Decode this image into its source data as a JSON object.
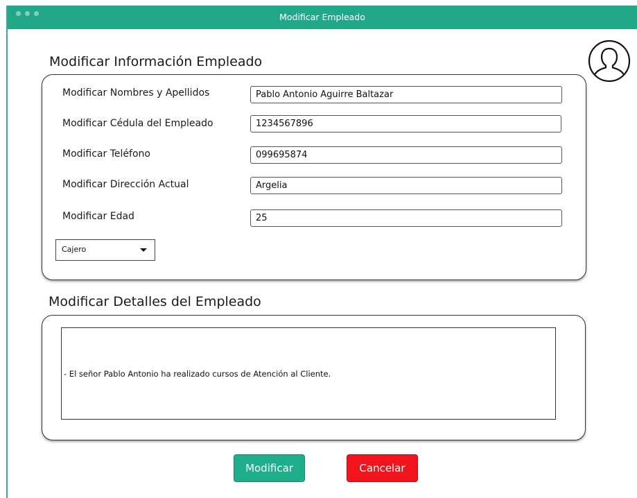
{
  "window": {
    "title": "Modificar Empleado"
  },
  "section_info": {
    "title": "Modificar Información Empleado",
    "fields": [
      {
        "label": "Modificar Nombres y Apellidos",
        "value": "Pablo Antonio Aguirre Baltazar"
      },
      {
        "label": "Modificar Cédula del Empleado",
        "value": "1234567896"
      },
      {
        "label": "Modificar Teléfono",
        "value": "099695874"
      },
      {
        "label": "Modificar Dirección Actual",
        "value": "Argelia"
      },
      {
        "label": "Modificar Edad",
        "value": "25"
      }
    ],
    "role_select": {
      "value": "Cajero"
    }
  },
  "section_details": {
    "title": "Modificar Detalles del Empleado",
    "text": "- El señor Pablo Antonio ha realizado cursos de Atención al Cliente."
  },
  "actions": {
    "submit_label": "Modificar",
    "cancel_label": "Cancelar"
  },
  "icons": {
    "avatar": "user-avatar-icon"
  },
  "colors": {
    "titlebar": "#22a78a",
    "primary": "#1fae8c",
    "danger": "#f2141c"
  }
}
